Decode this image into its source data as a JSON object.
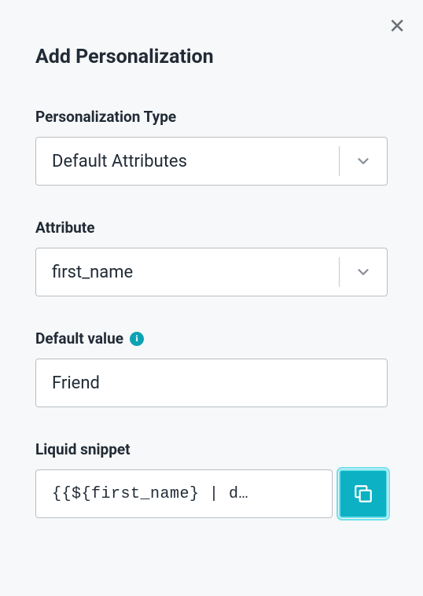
{
  "modal": {
    "title": "Add Personalization"
  },
  "fields": {
    "type": {
      "label": "Personalization Type",
      "value": "Default Attributes"
    },
    "attribute": {
      "label": "Attribute",
      "value": "first_name"
    },
    "default": {
      "label": "Default value",
      "value": "Friend"
    },
    "snippet": {
      "label": "Liquid snippet",
      "value": "{{${first_name} | d…"
    }
  }
}
